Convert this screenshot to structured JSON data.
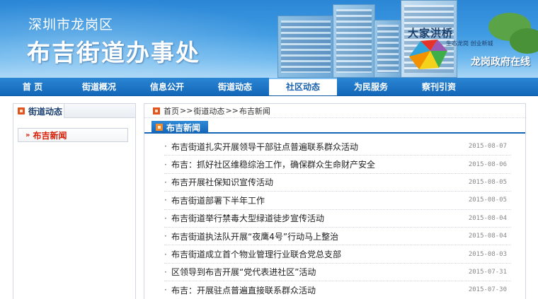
{
  "header": {
    "district": "深圳市龙岗区",
    "office": "布吉街道办事处",
    "sign": "大家洪桥",
    "slogan": "生态龙岗 创业新城",
    "online": "龙岗政府在线"
  },
  "nav": {
    "items": [
      {
        "label": "首 页"
      },
      {
        "label": "街道概况"
      },
      {
        "label": "信息公开"
      },
      {
        "label": "街道动态"
      },
      {
        "label": "社区动态"
      },
      {
        "label": "为民服务"
      },
      {
        "label": "察刊引资"
      }
    ],
    "active_index": 4
  },
  "sidebar": {
    "title": "街道动态",
    "links": [
      {
        "label": "布吉新闻",
        "arrow": "»"
      }
    ]
  },
  "breadcrumb": {
    "home": "首页",
    "sep": ">>",
    "level1": "街道动态",
    "level2": "布吉新闻"
  },
  "section": {
    "title": "布吉新闻"
  },
  "news": [
    {
      "title": "布吉街道扎实开展领导干部驻点普遍联系群众活动",
      "date": "2015-08-07"
    },
    {
      "title": "布吉：抓好社区维稳综治工作，确保群众生命财产安全",
      "date": "2015-08-06"
    },
    {
      "title": "布吉开展社保知识宣传活动",
      "date": "2015-08-05"
    },
    {
      "title": "布吉街道部署下半年工作",
      "date": "2015-08-05"
    },
    {
      "title": "布吉街道举行禁毒大型绿道徒步宣传活动",
      "date": "2015-08-04"
    },
    {
      "title": "布吉街道执法队开展“夜鹰4号”行动马上整治",
      "date": "2015-08-04"
    },
    {
      "title": "布吉街道成立首个物业管理行业联合党总支部",
      "date": "2015-08-03"
    },
    {
      "title": "区领导到布吉开展“党代表进社区”活动",
      "date": "2015-07-31"
    },
    {
      "title": "布吉：开展驻点普遍直接联系群众活动",
      "date": "2015-07-30"
    }
  ],
  "colors": {
    "nav": "#1467b8",
    "accent_red": "#d81e06",
    "icon_orange": "#e2541e"
  }
}
